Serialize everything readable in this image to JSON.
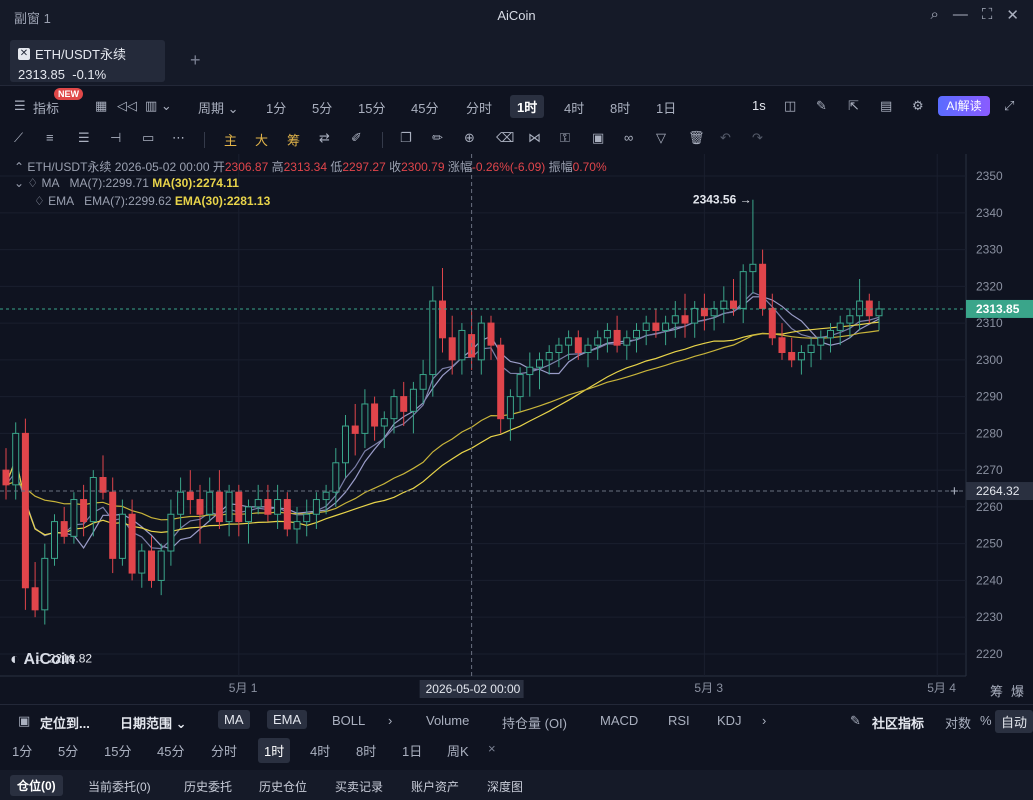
{
  "window": {
    "title": "副窗 1",
    "app": "AiCoin"
  },
  "symbol_tab": {
    "name": "ETH/USDT永续",
    "price": "2313.85",
    "change": "-0.1%",
    "icon": "x-close-icon"
  },
  "toolbar1": {
    "indicator": "指标",
    "badge": "NEW",
    "period_label": "周期",
    "periods": [
      "1分",
      "5分",
      "15分",
      "45分",
      "分时",
      "1时",
      "4时",
      "8时",
      "1日"
    ],
    "active_period": "1时",
    "speed": "1s",
    "ai": "AI解读"
  },
  "toolbar2": {
    "main": "主",
    "big": "大",
    "chip": "筹"
  },
  "info": {
    "line1_symbol": "ETH/USDT永续",
    "line1_date": "2026-05-02 00:00",
    "open_label": "开",
    "open": "2306.87",
    "high_label": "高",
    "high": "2313.34",
    "low_label": "低",
    "low": "2297.27",
    "close_label": "收",
    "close": "2300.79",
    "chg_label": "涨幅",
    "chg": "-0.26%(-6.09)",
    "amp_label": "振幅",
    "amp": "0.70%",
    "ma_label": "MA",
    "ma7": "MA(7):2299.71",
    "ma30": "MA(30):2274.11",
    "ema_label": "EMA",
    "ema7": "EMA(7):2299.62",
    "ema30": "EMA(30):2281.13"
  },
  "chart_data": {
    "type": "candlestick",
    "ylim": [
      2214,
      2356
    ],
    "yticks": [
      2220,
      2230,
      2240,
      2250,
      2260,
      2270,
      2280,
      2290,
      2300,
      2310,
      2320,
      2330,
      2340,
      2350
    ],
    "x_labels": [
      {
        "label": "5月 1",
        "index": 24
      },
      {
        "label": "5月 3",
        "index": 72
      },
      {
        "label": "5月 4",
        "index": 96
      }
    ],
    "crosshair": {
      "date": "2026-05-02 00:00",
      "index": 48,
      "price": "2264.32",
      "value": 2264.32
    },
    "last_price": {
      "label": "2313.85",
      "value": 2313.85
    },
    "max_marker": {
      "label": "2343.56",
      "value": 2343.56,
      "index": 77
    },
    "min_marker": {
      "label": "2218.82",
      "value": 2218.82,
      "index": 2
    },
    "candles": [
      [
        2270,
        2276,
        2262,
        2266
      ],
      [
        2266,
        2283,
        2262,
        2280
      ],
      [
        2280,
        2284,
        2232,
        2238
      ],
      [
        2238,
        2245,
        2230,
        2232
      ],
      [
        2232,
        2250,
        2228,
        2246
      ],
      [
        2246,
        2258,
        2244,
        2256
      ],
      [
        2256,
        2260,
        2250,
        2252
      ],
      [
        2252,
        2264,
        2250,
        2262
      ],
      [
        2262,
        2266,
        2252,
        2256
      ],
      [
        2256,
        2270,
        2252,
        2268
      ],
      [
        2268,
        2274,
        2262,
        2264
      ],
      [
        2264,
        2268,
        2242,
        2246
      ],
      [
        2246,
        2262,
        2244,
        2258
      ],
      [
        2258,
        2262,
        2240,
        2242
      ],
      [
        2242,
        2250,
        2238,
        2248
      ],
      [
        2248,
        2252,
        2238,
        2240
      ],
      [
        2240,
        2250,
        2236,
        2248
      ],
      [
        2248,
        2262,
        2244,
        2258
      ],
      [
        2258,
        2268,
        2254,
        2264
      ],
      [
        2264,
        2270,
        2258,
        2262
      ],
      [
        2262,
        2266,
        2250,
        2258
      ],
      [
        2258,
        2268,
        2256,
        2264
      ],
      [
        2264,
        2270,
        2254,
        2256
      ],
      [
        2256,
        2266,
        2252,
        2264
      ],
      [
        2264,
        2266,
        2252,
        2256
      ],
      [
        2256,
        2262,
        2250,
        2260
      ],
      [
        2260,
        2266,
        2258,
        2262
      ],
      [
        2262,
        2266,
        2256,
        2258
      ],
      [
        2258,
        2266,
        2254,
        2262
      ],
      [
        2262,
        2264,
        2252,
        2254
      ],
      [
        2254,
        2260,
        2250,
        2256
      ],
      [
        2256,
        2262,
        2252,
        2258
      ],
      [
        2258,
        2264,
        2254,
        2262
      ],
      [
        2262,
        2266,
        2258,
        2264
      ],
      [
        2264,
        2276,
        2260,
        2272
      ],
      [
        2272,
        2285,
        2268,
        2282
      ],
      [
        2282,
        2288,
        2274,
        2280
      ],
      [
        2280,
        2292,
        2276,
        2288
      ],
      [
        2288,
        2290,
        2278,
        2282
      ],
      [
        2282,
        2286,
        2276,
        2284
      ],
      [
        2284,
        2292,
        2280,
        2290
      ],
      [
        2290,
        2294,
        2282,
        2286
      ],
      [
        2286,
        2294,
        2280,
        2292
      ],
      [
        2292,
        2300,
        2288,
        2296
      ],
      [
        2296,
        2320,
        2290,
        2316
      ],
      [
        2316,
        2325,
        2302,
        2306
      ],
      [
        2306,
        2312,
        2296,
        2300
      ],
      [
        2300,
        2310,
        2296,
        2308
      ],
      [
        2306.87,
        2313.34,
        2297.27,
        2300.79
      ],
      [
        2300,
        2312,
        2296,
        2310
      ],
      [
        2310,
        2312,
        2300,
        2304
      ],
      [
        2304,
        2306,
        2280,
        2284
      ],
      [
        2284,
        2292,
        2278,
        2290
      ],
      [
        2290,
        2298,
        2286,
        2296
      ],
      [
        2296,
        2302,
        2290,
        2298
      ],
      [
        2298,
        2302,
        2292,
        2300
      ],
      [
        2300,
        2304,
        2296,
        2302
      ],
      [
        2302,
        2306,
        2298,
        2304
      ],
      [
        2304,
        2308,
        2300,
        2306
      ],
      [
        2306,
        2308,
        2300,
        2302
      ],
      [
        2302,
        2306,
        2298,
        2304
      ],
      [
        2304,
        2308,
        2300,
        2306
      ],
      [
        2306,
        2310,
        2302,
        2308
      ],
      [
        2308,
        2312,
        2302,
        2304
      ],
      [
        2304,
        2308,
        2300,
        2306
      ],
      [
        2306,
        2310,
        2302,
        2308
      ],
      [
        2308,
        2312,
        2304,
        2310
      ],
      [
        2310,
        2314,
        2306,
        2308
      ],
      [
        2308,
        2312,
        2304,
        2310
      ],
      [
        2310,
        2316,
        2306,
        2312
      ],
      [
        2312,
        2318,
        2306,
        2310
      ],
      [
        2310,
        2316,
        2306,
        2314
      ],
      [
        2314,
        2318,
        2308,
        2312
      ],
      [
        2312,
        2316,
        2308,
        2314
      ],
      [
        2314,
        2320,
        2310,
        2316
      ],
      [
        2316,
        2322,
        2312,
        2314
      ],
      [
        2314,
        2326,
        2310,
        2324
      ],
      [
        2324,
        2343.56,
        2318,
        2326
      ],
      [
        2326,
        2330,
        2312,
        2314
      ],
      [
        2314,
        2318,
        2304,
        2306
      ],
      [
        2306,
        2310,
        2300,
        2302
      ],
      [
        2302,
        2306,
        2298,
        2300
      ],
      [
        2300,
        2304,
        2296,
        2302
      ],
      [
        2302,
        2306,
        2298,
        2304
      ],
      [
        2304,
        2308,
        2300,
        2306
      ],
      [
        2306,
        2310,
        2302,
        2308
      ],
      [
        2308,
        2312,
        2304,
        2310
      ],
      [
        2310,
        2314,
        2306,
        2312
      ],
      [
        2312,
        2322,
        2308,
        2316
      ],
      [
        2316,
        2318,
        2310,
        2312
      ],
      [
        2312,
        2316,
        2308,
        2313.85
      ]
    ],
    "colors": {
      "up": "#3aa58a",
      "down": "#e0454b",
      "ma7": "#9a9cc8",
      "ma30": "#e8d44a"
    }
  },
  "axis_right": {
    "extra1": "筹",
    "extra2": "爆"
  },
  "indicator_bar": {
    "locate": "定位到...",
    "range": "日期范围",
    "main_inds": [
      "MA",
      "EMA",
      "BOLL"
    ],
    "sub_inds": [
      "Volume",
      "持仓量 (OI)",
      "MACD",
      "RSI",
      "KDJ"
    ],
    "community": "社区指标",
    "log": "对数",
    "pct": "%",
    "auto": "自动"
  },
  "period_bar": {
    "items": [
      "1分",
      "5分",
      "15分",
      "45分",
      "分时",
      "1时",
      "4时",
      "8时",
      "1日",
      "周K"
    ],
    "active": "1时"
  },
  "bottom_tabs": [
    "仓位(0)",
    "当前委托(0)",
    "历史委托",
    "历史仓位",
    "买卖记录",
    "账户资产",
    "深度图"
  ]
}
